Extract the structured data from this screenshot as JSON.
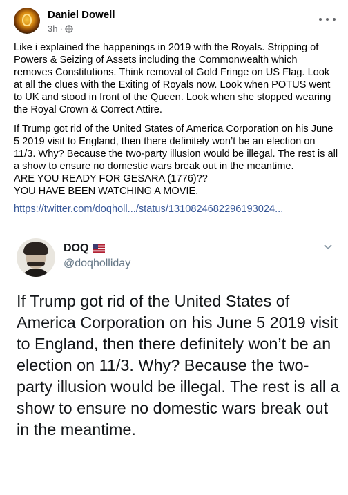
{
  "post": {
    "author": "Daniel Dowell",
    "time": "3h",
    "dot": "·",
    "paragraph1": "Like i explained the happenings in 2019 with the Royals. Stripping of Powers & Seizing of Assets including the Commonwealth which removes Constitutions. Think removal of Gold Fringe on US Flag. Look at all the clues with the Exiting of Royals now. Look when POTUS went to UK and stood in front of the Queen. Look when she stopped wearing the Royal Crown & Correct Attire.",
    "paragraph2": "If Trump got rid of the United States of America Corporation on his June 5 2019 visit to England, then there definitely won’t be an election on 11/3. Why? Because the two-party illusion would be illegal. The rest is all a show to ensure no domestic wars break out in the meantime.\nARE YOU READY FOR GESARA (1776)??\nYOU HAVE BEEN WATCHING A MOVIE.",
    "link": "https://twitter.com/doqholl.../status/1310824682296193024..."
  },
  "embed": {
    "name": "DOQ",
    "handle": "@doqholliday",
    "text": "If Trump got rid of the United States of America Corporation on his June 5 2019 visit to England, then there definitely won’t be an election on 11/3. Why? Because the two-party illusion would be illegal. The rest is all a show to ensure no domestic wars break out in the meantime."
  },
  "icons": {
    "privacy": "globe-icon",
    "menu": "more-options-icon",
    "flag": "us-flag-icon",
    "chevron": "chevron-down-icon"
  },
  "colors": {
    "link": "#385898",
    "secondary_text": "#65676b",
    "handle": "#657786"
  }
}
